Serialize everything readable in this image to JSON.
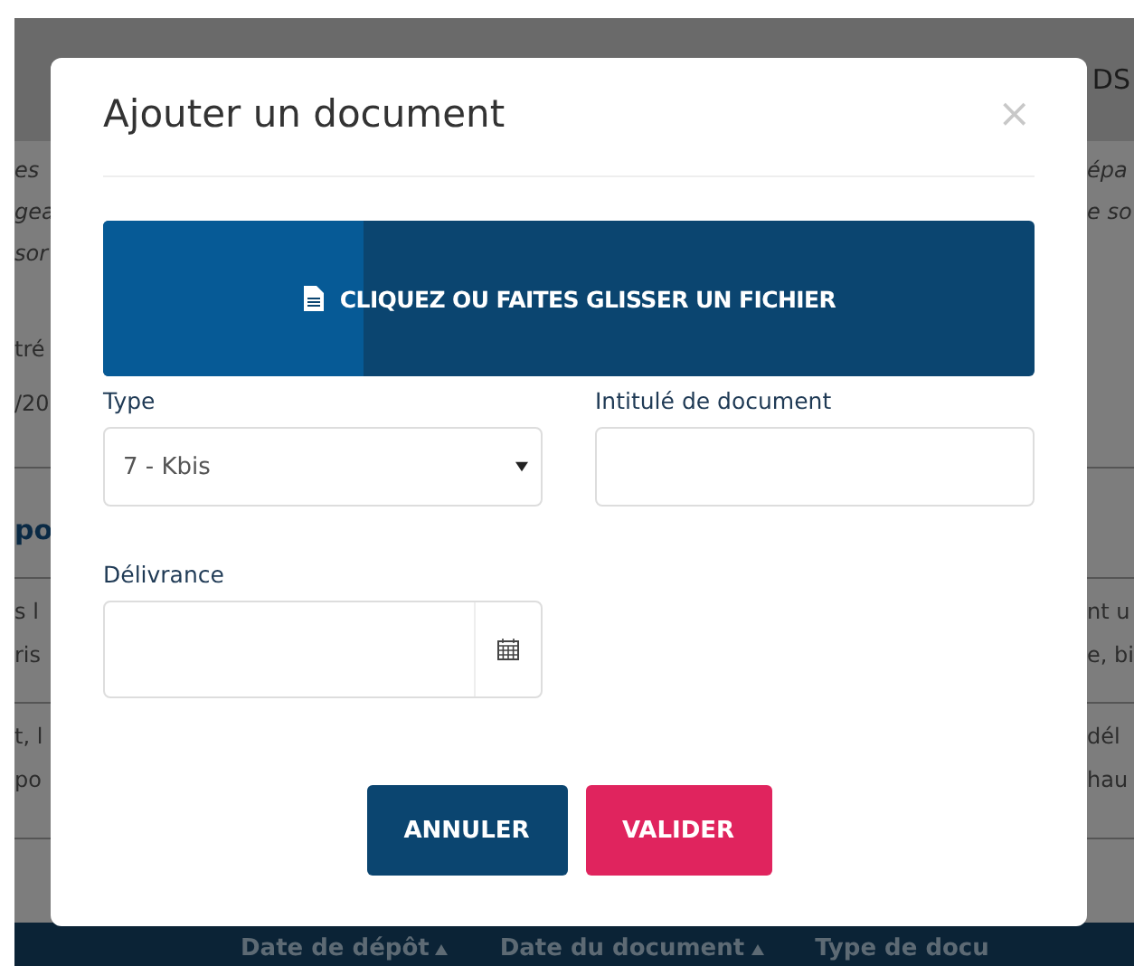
{
  "background": {
    "heading": "DS",
    "sections": [
      {
        "kind": "intro",
        "lines": [
          {
            "left": "es",
            "right": "épa"
          },
          {
            "left": "gea",
            "right": "e so"
          },
          {
            "left": "sor"
          }
        ]
      },
      {
        "kind": "info",
        "lines": [
          {
            "left": "tré"
          },
          {
            "left": "/20"
          }
        ]
      },
      {
        "kind": "heading",
        "lines": [
          {
            "left": "po"
          }
        ]
      },
      {
        "kind": "text",
        "lines": [
          {
            "left": "s l",
            "right": "nt u"
          },
          {
            "left": "ris",
            "right": "e, bi"
          }
        ]
      },
      {
        "kind": "text",
        "lines": [
          {
            "left": "t, l",
            "right": "dél"
          },
          {
            "left": "po",
            "right": "hau"
          }
        ]
      }
    ],
    "table_headers": [
      {
        "label": "Date de dépôt",
        "sortable": true
      },
      {
        "label": "Date du document",
        "sortable": true
      },
      {
        "label": "Type de docu",
        "sortable": false
      }
    ]
  },
  "modal": {
    "title": "Ajouter un document",
    "close": "×",
    "upload": {
      "label": "CLIQUEZ OU FAITES GLISSER UN FICHIER",
      "level": 0.28
    },
    "fields": [
      {
        "kind": "select",
        "label": "Type",
        "value": "7 - Kbis"
      },
      {
        "kind": "text",
        "label": "Intitulé de document"
      },
      {
        "kind": "date",
        "label": "Délivrance"
      }
    ],
    "buttons": [
      {
        "kind": "secondary",
        "label": "ANNULER"
      },
      {
        "kind": "primary",
        "label": "VALIDER"
      }
    ]
  }
}
